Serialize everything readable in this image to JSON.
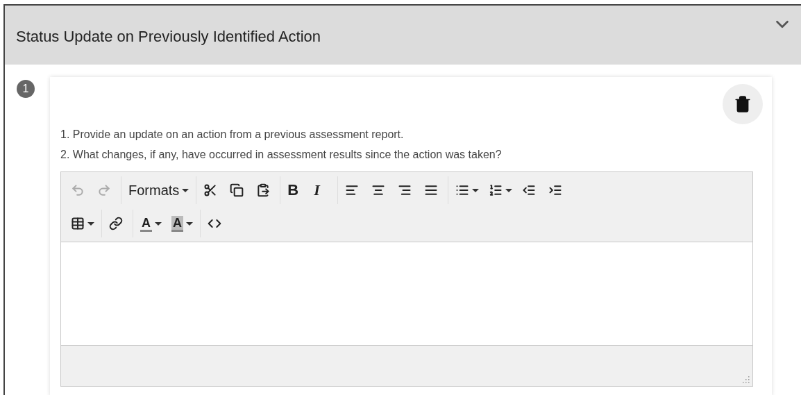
{
  "panel": {
    "title": "Status Update on Previously Identified Action",
    "expanded": true
  },
  "items": [
    {
      "number": "1",
      "instructions": [
        "1. Provide an update on an action from a previous assessment report.",
        "2. What changes, if any, have occurred in assessment results since the action was taken?"
      ],
      "editor": {
        "undo": {
          "disabled": true
        },
        "redo": {
          "disabled": true
        },
        "formats": {
          "label": "Formats"
        },
        "bold": {
          "label": "B"
        },
        "italic": {
          "label": "I"
        },
        "text_color": {
          "label": "A"
        },
        "background_color": {
          "label": "A"
        }
      }
    }
  ]
}
